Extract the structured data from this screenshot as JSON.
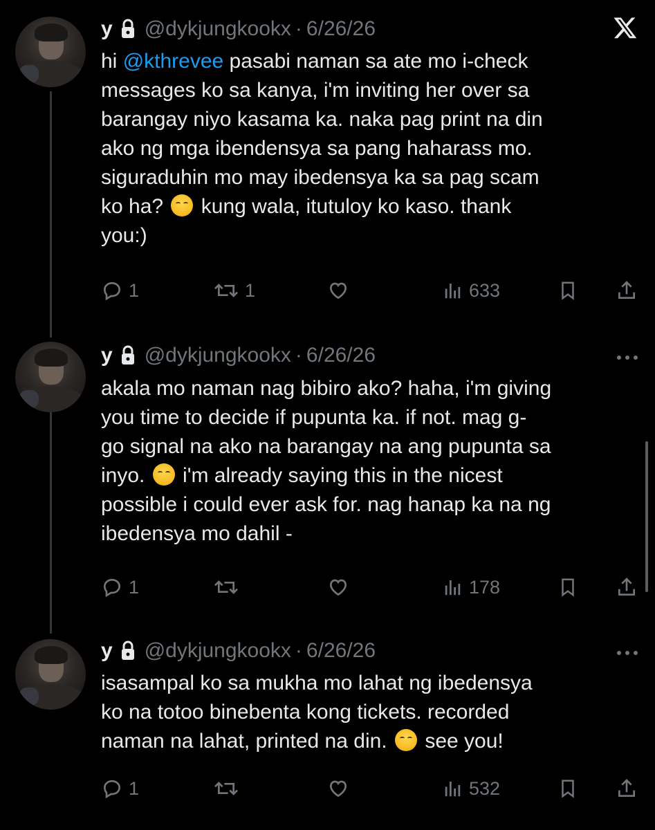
{
  "tweets": [
    {
      "name": "y",
      "handle": "@dykjungkookx",
      "separator": "·",
      "date": "6/26/26",
      "lines": [
        {
          "pre": "hi ",
          "mention": "@kthrevee",
          "post": " pasabi naman sa ate mo i-check"
        },
        {
          "pre": "messages ko sa kanya, i'm inviting her over sa"
        },
        {
          "pre": "barangay niyo kasama ka. naka pag print na din"
        },
        {
          "pre": "ako ng mga ibendensya sa pang haharass mo."
        },
        {
          "pre": "siguraduhin mo may ibedensya ka sa pag scam"
        },
        {
          "pre": "ko ha?",
          "emoji": true,
          "post": " kung wala, itutuloy ko kaso. thank"
        },
        {
          "pre": "you:)"
        }
      ],
      "replies": "1",
      "reposts": "1",
      "views": "633"
    },
    {
      "name": "y",
      "handle": "@dykjungkookx",
      "separator": "·",
      "date": "6/26/26",
      "lines": [
        {
          "pre": "akala mo naman nag bibiro ako? haha, i'm giving"
        },
        {
          "pre": "you time to decide if pupunta ka. if not. mag g-"
        },
        {
          "pre": "go signal na ako na barangay na ang pupunta sa"
        },
        {
          "pre": "inyo.",
          "emoji": true,
          "post": " i'm already saying this in the nicest"
        },
        {
          "pre": "possible i could ever ask for. nag hanap ka na ng"
        },
        {
          "pre": "ibedensya mo dahil -"
        }
      ],
      "replies": "1",
      "reposts": "",
      "views": "178"
    },
    {
      "name": "y",
      "handle": "@dykjungkookx",
      "separator": "·",
      "date": "6/26/26",
      "lines": [
        {
          "pre": "isasampal ko sa mukha mo lahat ng ibedensya"
        },
        {
          "pre": "ko na totoo binebenta kong tickets. recorded"
        },
        {
          "pre": "naman na lahat, printed na din.",
          "emoji": true,
          "post": " see you!"
        }
      ],
      "replies": "1",
      "reposts": "",
      "views": "532"
    }
  ],
  "colors": {
    "background": "#000000",
    "text": "#e7e9ea",
    "secondary": "#71767b",
    "mention": "#1d9bf0",
    "thread_line": "#333639"
  },
  "icons": [
    "x-logo-icon",
    "lock-icon",
    "more-icon",
    "reply-icon",
    "repost-icon",
    "like-icon",
    "views-icon",
    "bookmark-icon",
    "share-icon"
  ]
}
